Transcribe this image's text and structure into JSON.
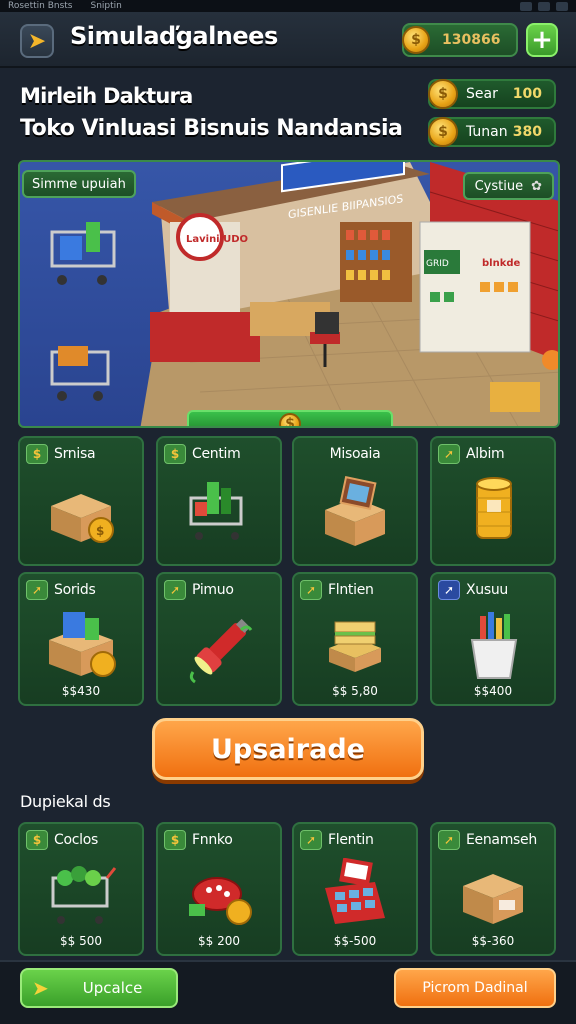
{
  "statusbar": {
    "left_text": "Rosettin Bnsts",
    "tab_text": "Sniptin"
  },
  "header": {
    "title": "Simulaďgalnees",
    "coins": "130866",
    "back_icon": "back-arrow-icon",
    "plus_icon": "plus-icon"
  },
  "store": {
    "name_line1": "Mirleih Daktura",
    "name_line2": "Toko Vinluasi Bisnuis Nandansia"
  },
  "stats": [
    {
      "label": "Sear",
      "value": "100"
    },
    {
      "label": "Tunan",
      "value": "380"
    }
  ],
  "scene": {
    "tag": "Simme upuiah",
    "button": "Cystiue",
    "store_sign": "GISENLIE BIIPANSIOS",
    "shop_sign": "Lavini UDO",
    "right_sign": "blnkde",
    "right_small_sign": "GRID"
  },
  "grid1": [
    {
      "name": "Srnisa",
      "icon": "coin-icon",
      "art": "box-with-coin"
    },
    {
      "name": "Centim",
      "icon": "coin-icon",
      "art": "shopping-cart"
    },
    {
      "name": "Misoaia",
      "icon": "",
      "art": "box-with-picture"
    },
    {
      "name": "Albim",
      "icon": "arrow-icon",
      "art": "coin-stack"
    }
  ],
  "grid2": [
    {
      "name": "Sorids",
      "icon": "arrow-icon",
      "art": "goods-box",
      "price": "$$430"
    },
    {
      "name": "Pimuo",
      "icon": "arrow-icon",
      "art": "flashlight",
      "price": ""
    },
    {
      "name": "Flntien",
      "icon": "arrow-icon",
      "art": "sandwich",
      "price": "$$ 5,80"
    },
    {
      "name": "Xusuu",
      "icon": "arrow-blue-icon",
      "art": "bucket",
      "price": "$$400"
    }
  ],
  "upgrade_label": "Upsairade",
  "section_title": "Dupiekal ds",
  "grid3": [
    {
      "name": "Coclos",
      "icon": "coin-icon",
      "art": "cart-vegetables",
      "price": "$$ 500"
    },
    {
      "name": "Fnnko",
      "icon": "coin-icon",
      "art": "red-toy",
      "price": "$$ 200"
    },
    {
      "name": "Flentin",
      "icon": "arrow-icon",
      "art": "cash-register",
      "price": "$$-500"
    },
    {
      "name": "Eenamseh",
      "icon": "arrow-icon",
      "art": "cardboard-box",
      "price": "$$-360"
    }
  ],
  "bottom": {
    "left_button": "Upcalce",
    "right_button": "Picrom Dadinal"
  },
  "colors": {
    "accent_green": "#3a9a2a",
    "accent_orange": "#f07010",
    "coin_gold": "#e8a316",
    "card_bg": "#1f4f2c",
    "bg": "#1c2430"
  }
}
